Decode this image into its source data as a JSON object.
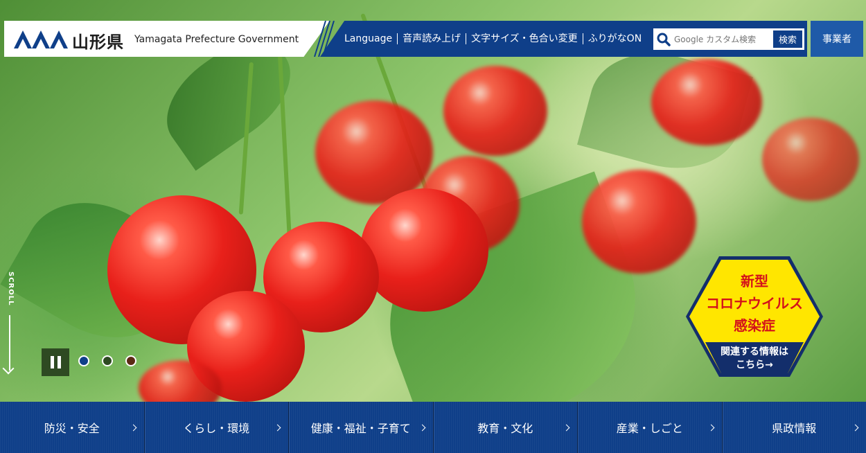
{
  "header": {
    "logo_jp": "山形県",
    "logo_en": "Yamagata Prefecture Government",
    "links": [
      "Language",
      "音声読み上げ",
      "文字サイズ・色合い変更",
      "ふりがなON"
    ],
    "search_placeholder": "Google カスタム検索",
    "search_button": "検索",
    "business_button": "事業者"
  },
  "hero": {
    "scroll_label": "SCROLL",
    "slide_count": 3,
    "active_slide": 1
  },
  "badge": {
    "title_lines": [
      "新型",
      "コロナウイルス",
      "感染症"
    ],
    "sub_lines": [
      "関連する情報は",
      "こちら→"
    ]
  },
  "categories": [
    "防災・安全",
    "くらし・環境",
    "健康・福祉・子育て",
    "教育・文化",
    "産業・しごと",
    "県政情報"
  ],
  "colors": {
    "navy": "#0f3f89",
    "business_blue": "#1f5aa8",
    "badge_yellow": "#ffe600",
    "badge_red": "#d4121a",
    "badge_navy": "#132e6b"
  }
}
